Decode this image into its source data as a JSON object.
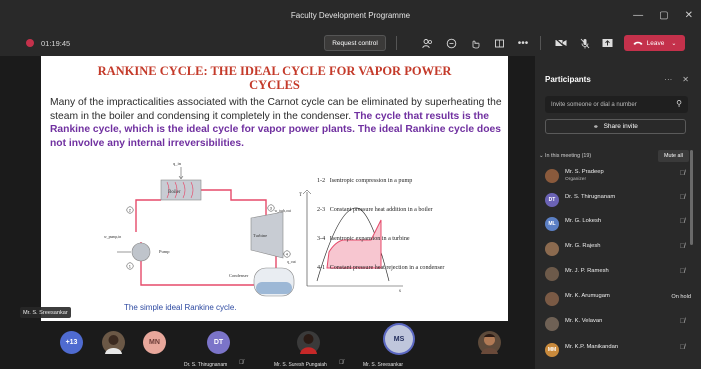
{
  "window": {
    "title": "Faculty Development Programme",
    "controls": [
      "—",
      "▢",
      "✕"
    ]
  },
  "toolbar": {
    "timer": "01:19:45",
    "request_control": "Request control",
    "leave": "Leave",
    "colors": {
      "record": "#c4314b",
      "leave": "#c4314b"
    }
  },
  "slide": {
    "title_line1": "RANKINE CYCLE: THE IDEAL CYCLE  FOR VAPOR POWER",
    "title_line2": "CYCLES",
    "body_normal": "Many of the impracticalities associated with the Carnot cycle can be eliminated by superheating the steam in the boiler and condensing it completely in the condenser.",
    "body_purple": " The cycle that results is the Rankine cycle, which is the ideal cycle for vapor power plants. The ideal Rankine cycle does not involve any internal irreversibilities.",
    "processes": [
      "1-2   Isentropic compression in a pump",
      "2-3   Constant pressure heat addition in a boiler",
      "3-4   Isentropic expansion in a turbine",
      "4-1   Constant pressure heat rejection in a condenser"
    ],
    "diagram": {
      "boiler": "Boiler",
      "turbine": "Turbine",
      "pump": "Pump",
      "condenser": "Condenser",
      "q_in": "q_in",
      "w_turb_out": "w_turb,out",
      "w_pump_in": "w_pump,in",
      "q_out": "q_out",
      "states": [
        "1",
        "2",
        "3",
        "4"
      ]
    },
    "ts_plot": {
      "ylabel": "T",
      "xlabel": "s"
    },
    "caption": "The simple ideal Rankine cycle.",
    "presenter_tag": "Mr. S. Sreesankar"
  },
  "gallery": {
    "overflow": "+13",
    "avatars": [
      {
        "initials": "",
        "label": ""
      },
      {
        "initials": "MN",
        "label": ""
      },
      {
        "initials": "DT",
        "label": "Dr. S. Thirugnanam"
      },
      {
        "initials": "",
        "label": "Mr. S. Suresh Pungaiah"
      },
      {
        "initials": "MS",
        "label": "Mr. S. Sreesankar"
      },
      {
        "initials": "",
        "label": ""
      }
    ]
  },
  "participants": {
    "title": "Participants",
    "search_placeholder": "Invite someone or dial a number",
    "share_invite": "Share invite",
    "section": "In this meeting (19)",
    "mute_all": "Mute all",
    "people": [
      {
        "name": "Mr. S. Pradeep",
        "sub": "Organizer",
        "initials": "",
        "color": "#8a5a3c",
        "status": ""
      },
      {
        "name": "Dr. S. Thirugnanam",
        "sub": "",
        "initials": "DT",
        "color": "#6b63b5",
        "status": ""
      },
      {
        "name": "Mr. G. Lokesh",
        "sub": "",
        "initials": "ML",
        "color": "#5b7fc4",
        "status": ""
      },
      {
        "name": "Mr. G. Rajesh",
        "sub": "",
        "initials": "",
        "color": "#8b6a4f",
        "status": ""
      },
      {
        "name": "Mr. J. P. Ramesh",
        "sub": "",
        "initials": "",
        "color": "#6d5a4a",
        "status": ""
      },
      {
        "name": "Mr. K. Arumugam",
        "sub": "",
        "initials": "",
        "color": "#7a5a45",
        "status": "On hold"
      },
      {
        "name": "Mr. K. Velavan",
        "sub": "",
        "initials": "",
        "color": "#6f6155",
        "status": ""
      },
      {
        "name": "Mr. K.P. Manikandan",
        "sub": "",
        "initials": "MM",
        "color": "#c98a3c",
        "status": ""
      }
    ]
  }
}
